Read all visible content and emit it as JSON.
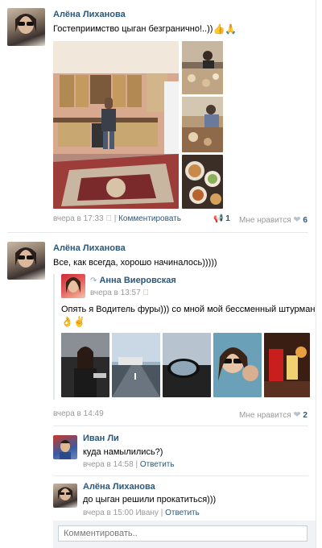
{
  "post1": {
    "author": "Алёна Лиханова",
    "text": "Гостеприимство цыган безгранично!..))",
    "emoji": "👍🙏",
    "time": "вчера в 17:33",
    "comment_link": "Комментировать",
    "shares_count": "1",
    "likes_label": "Мне нравится",
    "likes_count": "6"
  },
  "post2": {
    "author": "Алёна Лиханова",
    "text": "Все, как всегда, хорошо начиналось)))))",
    "repost": {
      "author": "Анна Виеровская",
      "time": "вчера в 13:57",
      "text": "Опять я Водитель фуры))) со мной мой бессменный штурман",
      "emoji": "👌✌"
    },
    "time": "вчера в 14:49",
    "likes_label": "Мне нравится",
    "likes_count": "2"
  },
  "comments": [
    {
      "author": "Иван Ли",
      "text": "куда намылились?)",
      "time": "вчера в 14:58",
      "reply": "Ответить"
    },
    {
      "author": "Алёна Лиханова",
      "text": "до цыган решили прокатиться)))",
      "time": "вчера в 15:00",
      "to": "Ивану",
      "reply": "Ответить"
    }
  ],
  "comment_input": {
    "placeholder": "Комментировать.."
  },
  "colors": {
    "link": "#2b587a",
    "meta": "#999999",
    "divider": "#e7e8ec"
  }
}
